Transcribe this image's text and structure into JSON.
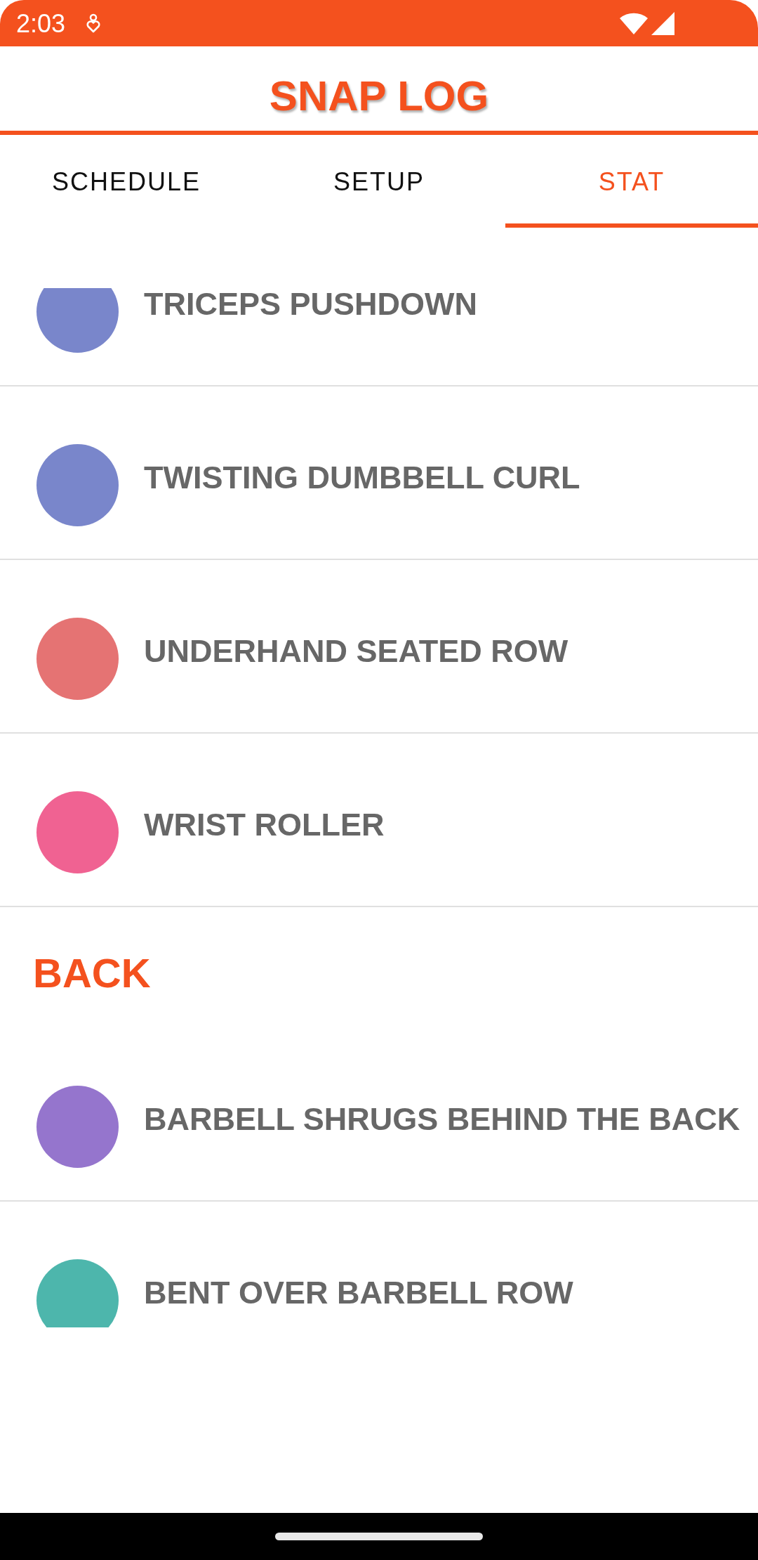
{
  "status_bar": {
    "time": "2:03"
  },
  "app_bar": {
    "title": "SNAP LOG"
  },
  "tabs": [
    {
      "label": "SCHEDULE",
      "selected": false
    },
    {
      "label": "SETUP",
      "selected": false
    },
    {
      "label": "STAT",
      "selected": true
    }
  ],
  "list": [
    {
      "kind": "exercise",
      "name": "TRICEPS PUSHDOWN",
      "color": "#7986cb"
    },
    {
      "kind": "exercise",
      "name": "TWISTING DUMBBELL CURL",
      "color": "#7986cb"
    },
    {
      "kind": "exercise",
      "name": "UNDERHAND SEATED ROW",
      "color": "#e57373"
    },
    {
      "kind": "exercise",
      "name": "WRIST ROLLER",
      "color": "#f06292"
    },
    {
      "kind": "section",
      "title": "BACK"
    },
    {
      "kind": "exercise",
      "name": "BARBELL SHRUGS BEHIND THE BACK",
      "color": "#9575cd"
    },
    {
      "kind": "exercise",
      "name": "BENT OVER BARBELL ROW",
      "color": "#4db6ac"
    }
  ]
}
